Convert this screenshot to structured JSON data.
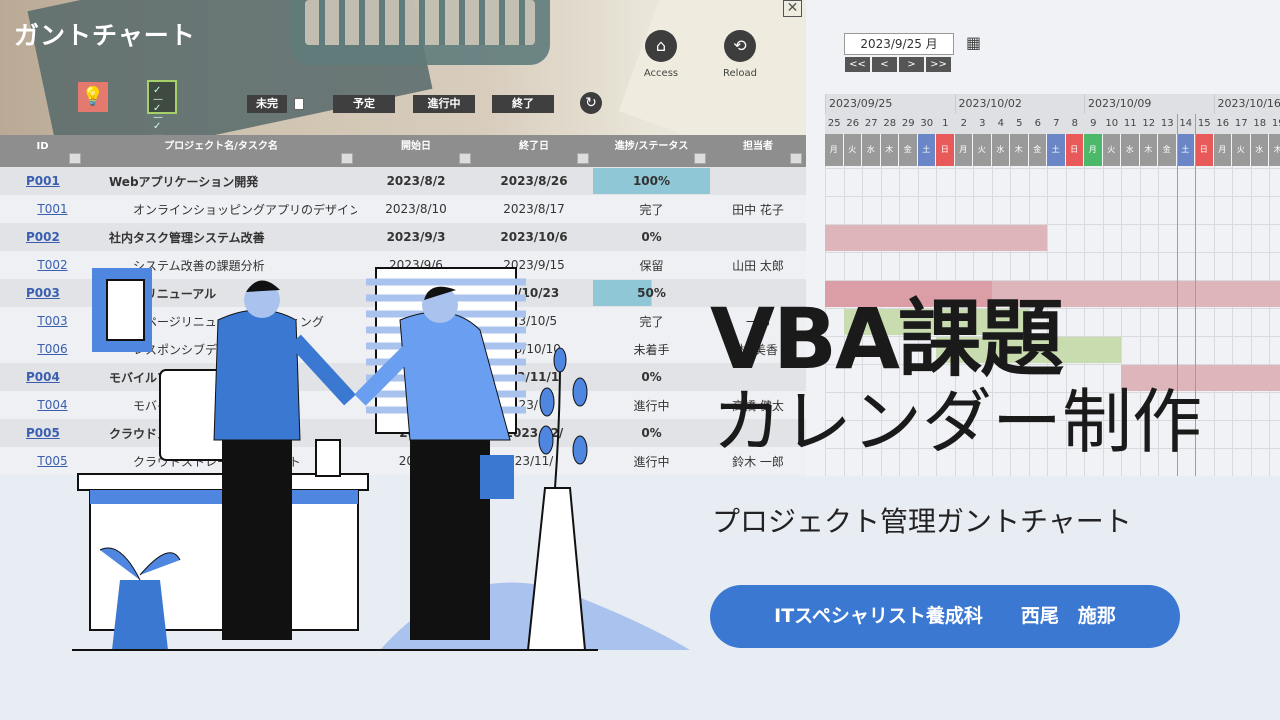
{
  "app": {
    "title": "ガントチャート",
    "close_icon": "close-icon",
    "icons": [
      "lightbulb-icon",
      "checklist-icon"
    ]
  },
  "filters": {
    "incomplete_label": "未完",
    "planned": "予定",
    "in_progress": "進行中",
    "done": "終了",
    "refresh_icon": "refresh-icon"
  },
  "actions": {
    "access": "Access",
    "reload": "Reload"
  },
  "calendar": {
    "date": "2023/9/25 月",
    "nav": [
      "<<",
      "<",
      ">",
      ">>"
    ],
    "weeks": [
      "2023/09/25",
      "2023/10/02",
      "2023/10/09",
      "2023/10/16"
    ],
    "days": [
      "25",
      "26",
      "27",
      "28",
      "29",
      "30",
      "1",
      "2",
      "3",
      "4",
      "5",
      "6",
      "7",
      "8",
      "9",
      "10",
      "11",
      "12",
      "13",
      "14",
      "15",
      "16",
      "17",
      "18",
      "19"
    ],
    "dows": [
      "月",
      "火",
      "水",
      "木",
      "金",
      "土",
      "日",
      "月",
      "火",
      "水",
      "木",
      "金",
      "土",
      "日",
      "月",
      "火",
      "水",
      "木",
      "金",
      "土",
      "日",
      "月",
      "火",
      "水",
      "木"
    ],
    "colors": {
      "sat": "#6b86c6",
      "sun": "#e85a5a",
      "holiday": "#4cb86a",
      "plan": "#dfb5bc",
      "actual": "#c8dcb0"
    }
  },
  "table": {
    "headers": [
      "ID",
      "プロジェクト名/タスク名",
      "開始日",
      "終了日",
      "進捗/ステータス",
      "担当者"
    ],
    "rows": [
      {
        "type": "p",
        "id": "P001",
        "name": "Webアプリケーション開発",
        "start": "2023/8/2",
        "end": "2023/8/26",
        "status": "100%",
        "owner": "",
        "progress": 100
      },
      {
        "type": "t",
        "id": "T001",
        "name": "オンラインショッピングアプリのデザイン",
        "start": "2023/8/10",
        "end": "2023/8/17",
        "status": "完了",
        "owner": "田中 花子"
      },
      {
        "type": "p",
        "id": "P002",
        "name": "社内タスク管理システム改善",
        "start": "2023/9/3",
        "end": "2023/10/6",
        "status": "0%",
        "owner": "",
        "progress": 0
      },
      {
        "type": "t",
        "id": "T002",
        "name": "システム改善の課題分析",
        "start": "2023/9/6",
        "end": "2023/9/15",
        "status": "保留",
        "owner": "山田 太郎"
      },
      {
        "type": "p",
        "id": "P003",
        "name": "ページリニューアル",
        "start": "",
        "end": "3/10/23",
        "status": "50%",
        "owner": "",
        "progress": 50
      },
      {
        "type": "t",
        "id": "T003",
        "name": "ムページリニュー　のコーディング",
        "start": "",
        "end": "23/10/5",
        "status": "完了",
        "owner": "一郎"
      },
      {
        "type": "t",
        "id": "T006",
        "name": "レスポンシブデ",
        "start": "",
        "end": "23/10/10",
        "status": "未着手",
        "owner": "林 美香"
      },
      {
        "type": "p",
        "id": "P004",
        "name": "モバイルア",
        "start": "",
        "end": "23/11/1",
        "status": "0%",
        "owner": "",
        "progress": 0
      },
      {
        "type": "t",
        "id": "T004",
        "name": "モバイ",
        "start": "",
        "end": "23/ 6",
        "status": "進行中",
        "owner": "高橋 健太"
      },
      {
        "type": "p",
        "id": "P005",
        "name": "クラウドス",
        "start": "2023",
        "end": "2023 12/",
        "status": "0%",
        "owner": "",
        "progress": 0
      },
      {
        "type": "t",
        "id": "T005",
        "name": "クラウドストレージ　　テスト",
        "start": "2023/",
        "end": "23/11/",
        "status": "進行中",
        "owner": "鈴木 一郎"
      }
    ]
  },
  "overlay": {
    "title_line1": "VBA課題",
    "title_line2": "カレンダー制作",
    "subtitle": "プロジェクト管理ガントチャート",
    "author": "ITスペシャリスト養成科　　西尾　施那",
    "accent": "#3a78d2"
  }
}
